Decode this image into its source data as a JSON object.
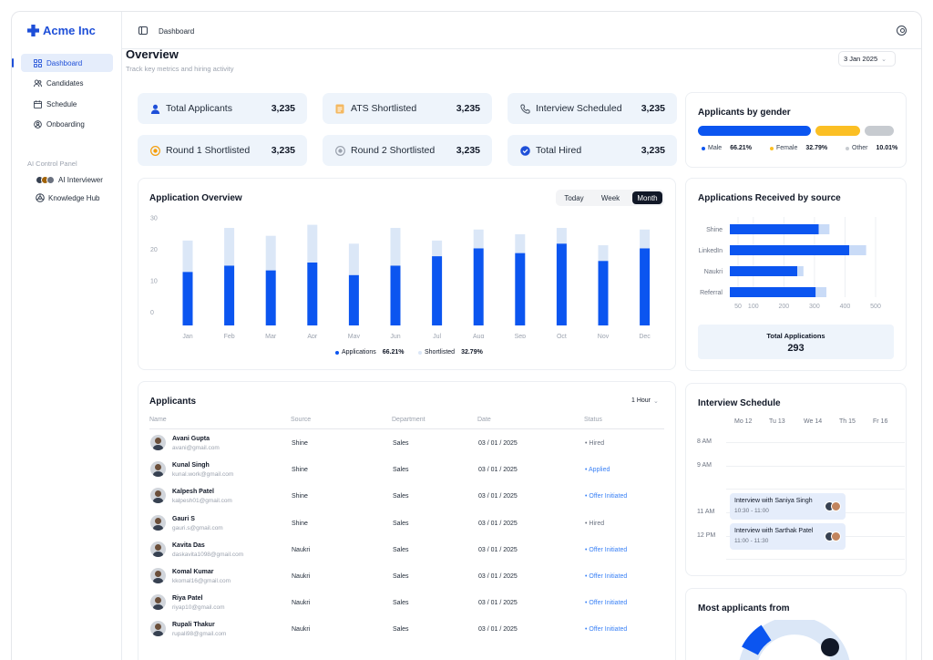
{
  "app": {
    "name": "Acme Inc"
  },
  "sidebar": {
    "items": [
      {
        "label": "Dashboard",
        "icon": "grid-icon"
      },
      {
        "label": "Candidates",
        "icon": "users-icon"
      },
      {
        "label": "Schedule",
        "icon": "calendar-icon"
      },
      {
        "label": "Onboarding",
        "icon": "onboarding-icon"
      }
    ],
    "section_label": "AI Control Panel",
    "ai_items": [
      {
        "label": "AI Interviewer"
      },
      {
        "label": "Knowledge Hub"
      }
    ]
  },
  "topbar": {
    "breadcrumb": "Dashboard"
  },
  "header": {
    "title": "Overview",
    "subtitle": "Track key metrics and hiring activity",
    "date": "3 Jan 2025"
  },
  "stats": [
    {
      "label": "Total Applicants",
      "value": "3,235",
      "icon": "person-icon"
    },
    {
      "label": "ATS Shortlisted",
      "value": "3,235",
      "icon": "document-icon"
    },
    {
      "label": "Interview Scheduled",
      "value": "3,235",
      "icon": "phone-icon"
    },
    {
      "label": "Round 1 Shortlisted",
      "value": "3,235",
      "icon": "badge-icon"
    },
    {
      "label": "Round 2 Shortlisted",
      "value": "3,235",
      "icon": "badge-icon"
    },
    {
      "label": "Total Hired",
      "value": "3,235",
      "icon": "check-circle-icon"
    }
  ],
  "gender": {
    "title": "Applicants by gender",
    "segments": [
      {
        "label": "Male",
        "value": "66.21%",
        "color": "#0b55f0"
      },
      {
        "label": "Female",
        "value": "32.79%",
        "color": "#fbbf24"
      },
      {
        "label": "Other",
        "value": "10.01%",
        "color": "#c7cbd0"
      }
    ]
  },
  "overview": {
    "title": "Application Overview",
    "ranges": [
      "Today",
      "Week",
      "Month"
    ],
    "active_range": "Month",
    "legend": [
      {
        "label": "Applications",
        "value": "66.21%",
        "color": "#0b55f0"
      },
      {
        "label": "Shortlisted",
        "value": "32.79%",
        "color": "#dbe7f7"
      }
    ]
  },
  "source_card": {
    "title": "Applications Received by source",
    "total_label": "Total Applications",
    "total_value": "293"
  },
  "applicants": {
    "title": "Applicants",
    "filter": "1 Hour",
    "columns": [
      "Name",
      "Source",
      "Department",
      "Date",
      "Status"
    ],
    "rows": [
      {
        "name": "Avani Gupta",
        "email": "avani@gmail.com",
        "source": "Shine",
        "department": "Sales",
        "date": "03 / 01 / 2025",
        "status": "Hired",
        "status_color": "#6b7280"
      },
      {
        "name": "Kunal Singh",
        "email": "kunal.work@gmail.com",
        "source": "Shine",
        "department": "Sales",
        "date": "03 / 01 / 2025",
        "status": "Applied",
        "status_color": "#3b82f6"
      },
      {
        "name": "Kalpesh Patel",
        "email": "kalpesh01@gmail.com",
        "source": "Shine",
        "department": "Sales",
        "date": "03 / 01 / 2025",
        "status": "Offer Initiated",
        "status_color": "#3b82f6"
      },
      {
        "name": "Gauri S",
        "email": "gauri.s@gmail.com",
        "source": "Shine",
        "department": "Sales",
        "date": "03 / 01 / 2025",
        "status": "Hired",
        "status_color": "#6b7280"
      },
      {
        "name": "Kavita Das",
        "email": "daskavita1098@gmail.com",
        "source": "Naukri",
        "department": "Sales",
        "date": "03 / 01 / 2025",
        "status": "Offer Initiated",
        "status_color": "#3b82f6"
      },
      {
        "name": "Komal Kumar",
        "email": "kkomal16@gmail.com",
        "source": "Naukri",
        "department": "Sales",
        "date": "03 / 01 / 2025",
        "status": "Offer Initiated",
        "status_color": "#3b82f6"
      },
      {
        "name": "Riya Patel",
        "email": "riyap10@gmail.com",
        "source": "Naukri",
        "department": "Sales",
        "date": "03 / 01 / 2025",
        "status": "Offer Initiated",
        "status_color": "#3b82f6"
      },
      {
        "name": "Rupali Thakur",
        "email": "rupali98@gmail.com",
        "source": "Naukri",
        "department": "Sales",
        "date": "03 / 01 / 2025",
        "status": "Offer Initiated",
        "status_color": "#3b82f6"
      }
    ]
  },
  "schedule": {
    "title": "Interview Schedule",
    "days": [
      "Mo 12",
      "Tu 13",
      "We 14",
      "Th 15",
      "Fr 16"
    ],
    "hours": [
      "8 AM",
      "9 AM",
      "11 AM",
      "12 PM"
    ],
    "events": [
      {
        "title": "Interview with Saniya Singh",
        "time": "10:30 - 11:00"
      },
      {
        "title": "Interview with Sarthak Patel",
        "time": "11:00 - 11:30"
      }
    ]
  },
  "most_from": {
    "title": "Most applicants from"
  },
  "chart_data": [
    {
      "type": "bar",
      "title": "Application Overview",
      "categories": [
        "Jan",
        "Feb",
        "Mar",
        "Apr",
        "May",
        "Jun",
        "Jul",
        "Aug",
        "Sep",
        "Oct",
        "Nov",
        "Dec"
      ],
      "series": [
        {
          "name": "Applications",
          "values": [
            17,
            19,
            17.5,
            20,
            16,
            19,
            22,
            24.5,
            23,
            26,
            20.5,
            24.5
          ],
          "color": "#0b55f0"
        },
        {
          "name": "Shortlisted",
          "values": [
            10,
            12,
            11,
            12,
            10,
            12,
            5,
            6,
            6,
            5,
            5,
            6
          ],
          "color": "#dbe7f7"
        }
      ],
      "stacked": true,
      "yticks": [
        0,
        10,
        20,
        30
      ],
      "ylim": [
        0,
        34
      ],
      "grid": false
    },
    {
      "type": "bar",
      "title": "Applications Received by source",
      "orientation": "horizontal",
      "categories": [
        "Shine",
        "LinkedIn",
        "Naukri",
        "Referral"
      ],
      "series": [
        {
          "name": "Applications",
          "values": [
            270,
            370,
            200,
            260
          ],
          "color": "#0b55f0"
        },
        {
          "name": "Shortlisted",
          "values": [
            35,
            55,
            20,
            35
          ],
          "color": "#c9dbf7"
        }
      ],
      "stacked": true,
      "xticks": [
        50,
        100,
        200,
        300,
        400,
        500
      ],
      "grid": true
    }
  ]
}
